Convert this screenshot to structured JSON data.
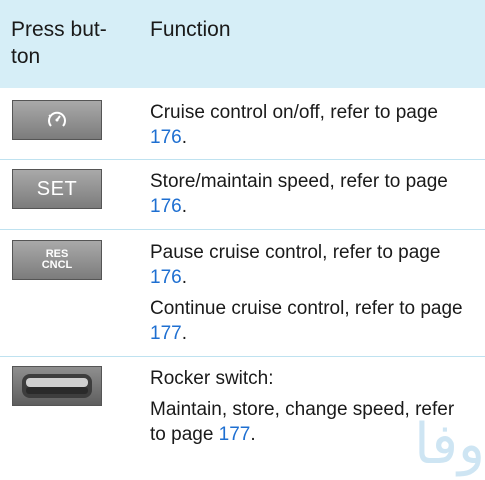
{
  "header": {
    "col1": "Press button",
    "col1_line1": "Press but-",
    "col1_line2": "ton",
    "col2": "Function"
  },
  "rows": [
    {
      "button": {
        "icon": "cruise-control-icon"
      },
      "lines": [
        {
          "text": "Cruise control on/off, refer to page ",
          "page": "176",
          "end": "."
        }
      ]
    },
    {
      "button": {
        "label": "SET"
      },
      "lines": [
        {
          "text": "Store/maintain speed, refer to page ",
          "page": "176",
          "end": "."
        }
      ]
    },
    {
      "button": {
        "label_top": "RES",
        "label_bottom": "CNCL"
      },
      "lines": [
        {
          "text": "Pause cruise control, refer to page ",
          "page": "176",
          "end": "."
        },
        {
          "text": "Continue cruise control, refer to page ",
          "page": "177",
          "end": "."
        }
      ]
    },
    {
      "button": {
        "icon": "rocker-switch-icon"
      },
      "lines": [
        {
          "text": "Rocker switch:"
        },
        {
          "text": "Maintain, store, change speed, refer to page ",
          "page": "177",
          "end": "."
        }
      ]
    }
  ],
  "watermark": "ﻭﻓﺎ",
  "colors": {
    "header_bg": "#d6eef7",
    "link": "#1e6fd1",
    "separator": "#bfe2f0"
  }
}
